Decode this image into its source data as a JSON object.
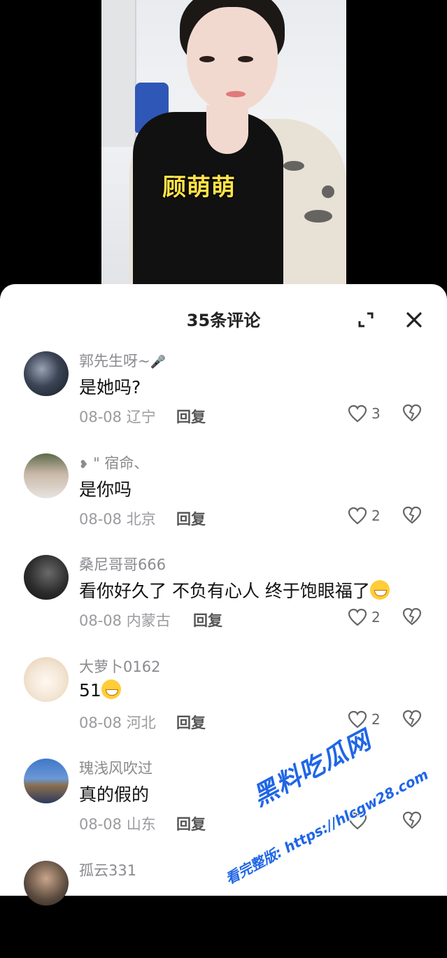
{
  "video": {
    "caption": "顾萌萌"
  },
  "sheet": {
    "title": "35条评论",
    "expand_icon": "expand-icon",
    "close_icon": "close-icon"
  },
  "comments": [
    {
      "username": "郭先生呀~",
      "username_suffix_icon": "microphone-icon",
      "content": "是她吗?",
      "date": "08-08",
      "location": "辽宁",
      "reply_label": "回复",
      "likes": "3"
    },
    {
      "username": "\" 宿命、",
      "username_prefix_icon": "play-arrow-icon",
      "content": "是你吗",
      "date": "08-08",
      "location": "北京",
      "reply_label": "回复",
      "likes": "2"
    },
    {
      "username": "桑尼哥哥666",
      "content": "看你好久了 不负有心人 终于饱眼福了",
      "content_emoji": "grinning-face-emoji",
      "date": "08-08",
      "location": "内蒙古",
      "reply_label": "回复",
      "likes": "2"
    },
    {
      "username": "大萝卜0162",
      "content": "51",
      "content_emoji": "laughing-tears-emoji",
      "date": "08-08",
      "location": "河北",
      "reply_label": "回复",
      "likes": "2"
    },
    {
      "username": "瑰浅风吹过",
      "content": "真的假的",
      "date": "08-08",
      "location": "山东",
      "reply_label": "回复",
      "likes": ""
    },
    {
      "username": "孤云331",
      "content": "",
      "date": "",
      "location": "",
      "reply_label": "",
      "likes": ""
    }
  ],
  "watermark": {
    "main": "黑料吃瓜网",
    "sub": "看完整版: https://hlcgw28.com"
  },
  "colors": {
    "caption_yellow": "#ffe24a",
    "watermark_blue": "#1f66e6"
  }
}
